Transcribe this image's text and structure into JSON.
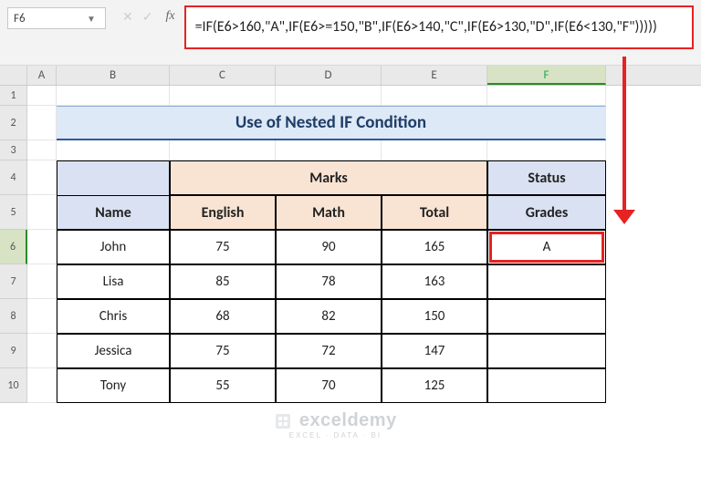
{
  "namebox": {
    "value": "F6"
  },
  "formula": "=IF(E6>160,\"A\",IF(E6>=150,\"B\",IF(E6>140,\"C\",IF(E6>130,\"D\",IF(E6<130,\"F\")))))",
  "columns": [
    "A",
    "B",
    "C",
    "D",
    "E",
    "F"
  ],
  "rows_labels": [
    "1",
    "2",
    "3",
    "4",
    "5",
    "6",
    "7",
    "8",
    "9",
    "10"
  ],
  "title": "Use of Nested IF Condition",
  "headers": {
    "marks": "Marks",
    "status": "Status",
    "name": "Name",
    "english": "English",
    "math": "Math",
    "total": "Total",
    "grades": "Grades"
  },
  "table": [
    {
      "name": "John",
      "english": 75,
      "math": 90,
      "total": 165,
      "grade": "A"
    },
    {
      "name": "Lisa",
      "english": 85,
      "math": 78,
      "total": 163,
      "grade": ""
    },
    {
      "name": "Chris",
      "english": 68,
      "math": 82,
      "total": 150,
      "grade": ""
    },
    {
      "name": "Jessica",
      "english": 75,
      "math": 72,
      "total": 147,
      "grade": ""
    },
    {
      "name": "Tony",
      "english": 55,
      "math": 70,
      "total": 125,
      "grade": ""
    }
  ],
  "watermark": {
    "main": "exceldemy",
    "sub": "EXCEL · DATA · BI"
  },
  "selected": {
    "cell": "F6",
    "col": "F",
    "row": 6
  }
}
